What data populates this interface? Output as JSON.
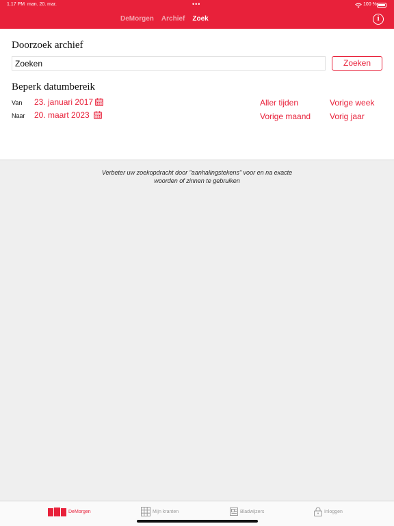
{
  "status_bar": {
    "time": "1.17 PM",
    "date": "man. 20. mar.",
    "dots": "•••",
    "battery": "100 %"
  },
  "nav": {
    "tabs": [
      {
        "label": "DeMorgen",
        "active": false
      },
      {
        "label": "Archief",
        "active": false
      },
      {
        "label": "Zoek",
        "active": true
      }
    ],
    "info_icon": "info-icon"
  },
  "search": {
    "heading": "Doorzoek archief",
    "placeholder": "Zoeken",
    "value": "",
    "button_label": "Zoeken"
  },
  "date_range": {
    "heading": "Beperk datumbereik",
    "from_label": "Van",
    "from_value": "23. januari 2017",
    "to_label": "Naar",
    "to_value": "20. maart 2023",
    "quick_options": [
      "Aller tijden",
      "Vorige week",
      "Vorige maand",
      "Vorig jaar"
    ]
  },
  "hint": "Verbeter uw zoekopdracht door \"aanhalingstekens\" voor en na exacte woorden of zinnen te gebruiken",
  "tabbar": {
    "items": [
      {
        "label": "DeMorgen",
        "icon": "newspaper-icon",
        "active": true
      },
      {
        "label": "Mijn kranten",
        "icon": "grid-icon",
        "active": false
      },
      {
        "label": "Bladwijzers",
        "icon": "bookmarks-icon",
        "active": false
      },
      {
        "label": "Inloggen",
        "icon": "lock-icon",
        "active": false
      }
    ]
  },
  "colors": {
    "brand": "#e8213a",
    "background": "#efefef",
    "inactive": "#9a9a9a"
  }
}
